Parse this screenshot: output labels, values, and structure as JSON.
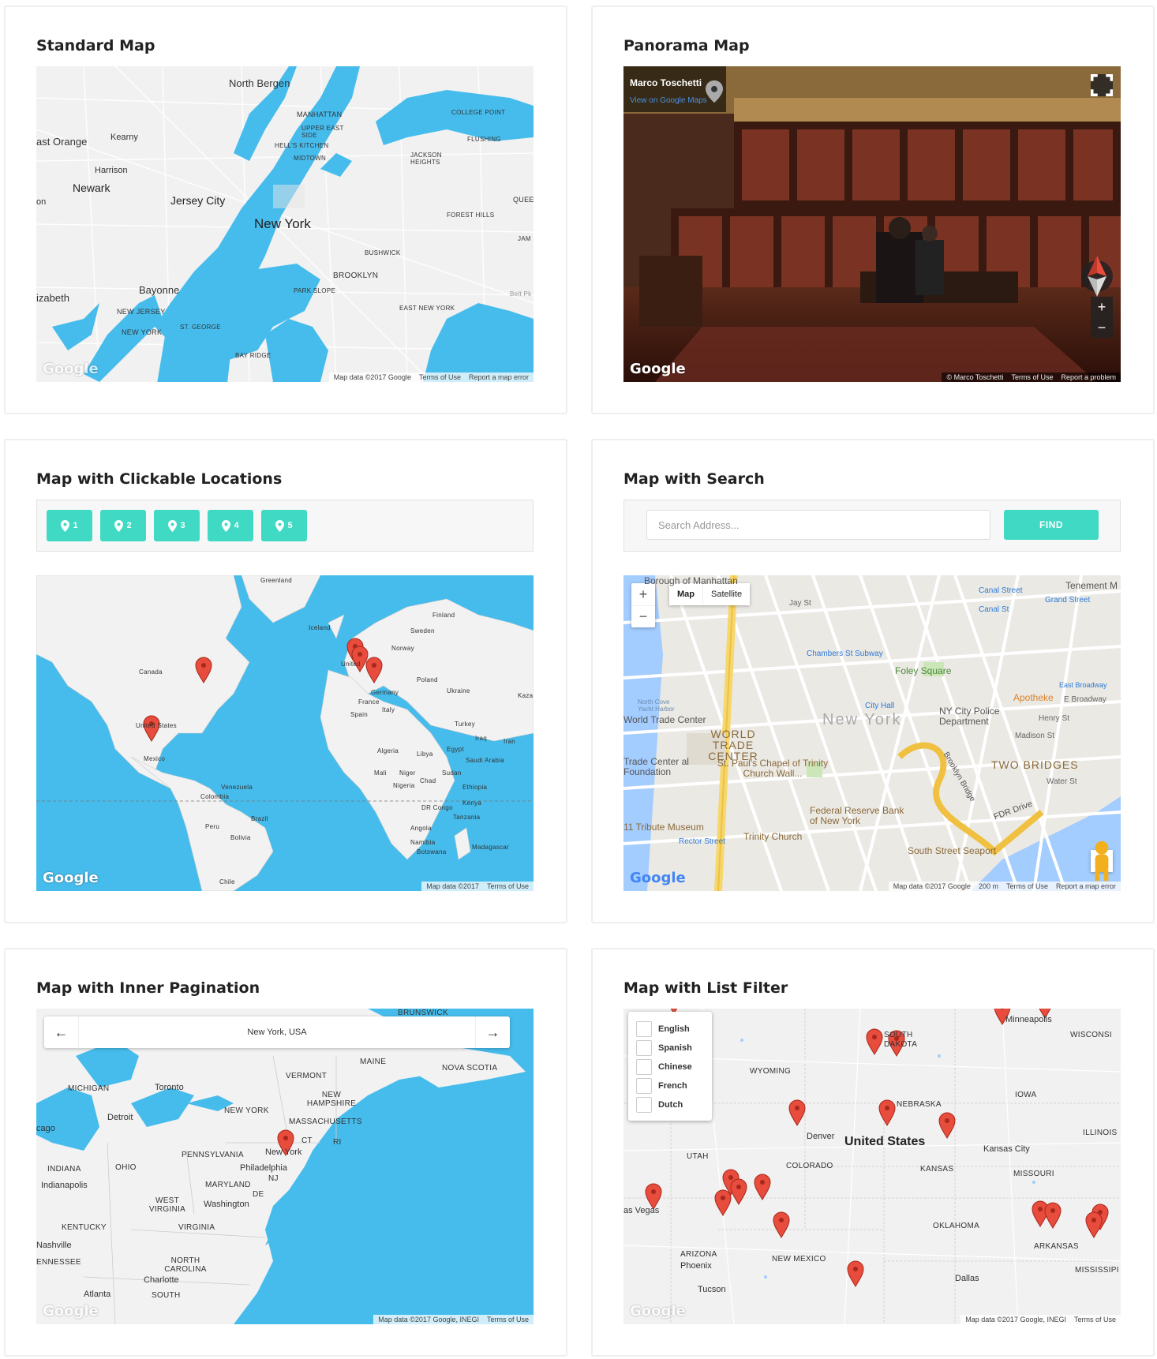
{
  "cards": {
    "standard": {
      "title": "Standard Map",
      "labels": [
        "North Bergen",
        "MANHATTAN",
        "UPPER EAST SIDE",
        "HELL'S KITCHEN",
        "MIDTOWN",
        "COLLEGE POINT",
        "FLUSHING",
        "Kearny",
        "Harrison",
        "JACKSON HEIGHTS",
        "Newark",
        "Jersey City",
        "New York",
        "FOREST HILLS",
        "BUSHWICK",
        "BROOKLYN",
        "Bayonne",
        "PARK SLOPE",
        "NEW JERSEY",
        "NEW YORK",
        "ST. GEORGE",
        "EAST NEW YORK",
        "BAY RIDGE",
        "ast Orange",
        "on",
        "izabeth",
        "QUEE",
        "JAM",
        "Belt Pk"
      ],
      "google": "Google",
      "attribution": [
        "Map data ©2017 Google",
        "Terms of Use",
        "Report a map error"
      ]
    },
    "panorama": {
      "title": "Panorama Map",
      "author": "Marco Toschetti",
      "view_link": "View on Google Maps",
      "google": "Google",
      "attribution": [
        "© Marco Toschetti",
        "Terms of Use",
        "Report a problem"
      ],
      "zoom_in": "+",
      "zoom_out": "−"
    },
    "clickable": {
      "title": "Map with Clickable Locations",
      "buttons": [
        "1",
        "2",
        "3",
        "4",
        "5"
      ],
      "labels": [
        "Greenland",
        "Iceland",
        "Finland",
        "Sweden",
        "Norway",
        "Canada",
        "United Kingdom",
        "Poland",
        "Germany",
        "Ukraine",
        "France",
        "Italy",
        "Spain",
        "Kaza",
        "Turkey",
        "United States",
        "Iraq",
        "Iran",
        "Mexico",
        "Algeria",
        "Libya",
        "Egypt",
        "Saudi Arabia",
        "Mali",
        "Niger",
        "Chad",
        "Sudan",
        "Nigeria",
        "Ethiopia",
        "Venezuela",
        "Colombia",
        "Kenya",
        "DR Congo",
        "Tanzania",
        "Peru",
        "Brazil",
        "Bolivia",
        "Angola",
        "Namibia",
        "Botswana",
        "Madagascar",
        "Chile"
      ],
      "google": "Google",
      "attribution": [
        "Map data ©2017",
        "Terms of Use"
      ]
    },
    "search": {
      "title": "Map with Search",
      "placeholder": "Search Address...",
      "find": "FIND",
      "map_type": [
        "Map",
        "Satellite"
      ],
      "labels": [
        "Borough of Manhattan",
        "Tenement M",
        "Canal Street",
        "Grand Street",
        "Canal St",
        "Jay St",
        "Chambers St Subway",
        "Foley Square",
        "Apotheke",
        "East Broadway",
        "E Broadway",
        "City Hall",
        "NY City Police Department",
        "Henry St",
        "Madison St",
        "World Trade Center",
        "WORLD TRADE CENTER",
        "New York",
        "St. Paul's Chapel of Trinity Church Wall...",
        "TWO BRIDGES",
        "Trade Center al Foundation",
        "Federal Reserve Bank of New York",
        "Water St",
        "11 Tribute Museum",
        "Trinity Church",
        "Rector Street",
        "South Street Seaport",
        "FDR Drive",
        "Brooklyn Bridge",
        "North Cove Yacht Harbor"
      ],
      "google": "Google",
      "attribution": [
        "Map data ©2017 Google",
        "200 m",
        "Terms of Use",
        "Report a map error"
      ]
    },
    "pagination": {
      "title": "Map with Inner Pagination",
      "current": "New York, USA",
      "prev": "←",
      "next": "→",
      "labels": [
        "MAINE",
        "NOVA SCOTIA",
        "VERMONT",
        "MICHIGAN",
        "Toronto",
        "NEW HAMPSHIRE",
        "NEW YORK",
        "MASSACHUSETTS",
        "Detroit",
        "CT",
        "RI",
        "cago",
        "PENNSYLVANIA",
        "New York",
        "Philadelphia",
        "INDIANA",
        "OHIO",
        "NJ",
        "Indianapolis",
        "MARYLAND",
        "DE",
        "WEST VIRGINIA",
        "Washington",
        "KENTUCKY",
        "VIRGINIA",
        "Nashville",
        "ENNESSEE",
        "NORTH CAROLINA",
        "Charlotte",
        "SOUTH",
        "Atlanta",
        "BRUNSWICK"
      ],
      "google": "Google",
      "attribution": [
        "Map data ©2017 Google, INEGI",
        "Terms of Use"
      ]
    },
    "filter": {
      "title": "Map with List Filter",
      "options": [
        "English",
        "Spanish",
        "Chinese",
        "French",
        "Dutch"
      ],
      "labels": [
        "Minneapolis",
        "SOUTH DAKOTA",
        "WISCONSI",
        "WYOMING",
        "IOWA",
        "NEBRASKA",
        "Denver",
        "United States",
        "ILLINOIS",
        "UTAH",
        "COLORADO",
        "KANSAS",
        "Kansas City",
        "MISSOURI",
        "as Vegas",
        "OKLAHOMA",
        "ARKANSAS",
        "ARIZONA",
        "Phoenix",
        "NEW MEXICO",
        "Dallas",
        "MISSISSIPI",
        "Tucson"
      ],
      "google": "Google",
      "attribution": [
        "Map data ©2017 Google, INEGI",
        "Terms of Use"
      ]
    }
  },
  "colors": {
    "accent": "#3fd9c4",
    "water": "#46bcec",
    "land": "#f2f2f2",
    "marker": "#e74c3c"
  }
}
